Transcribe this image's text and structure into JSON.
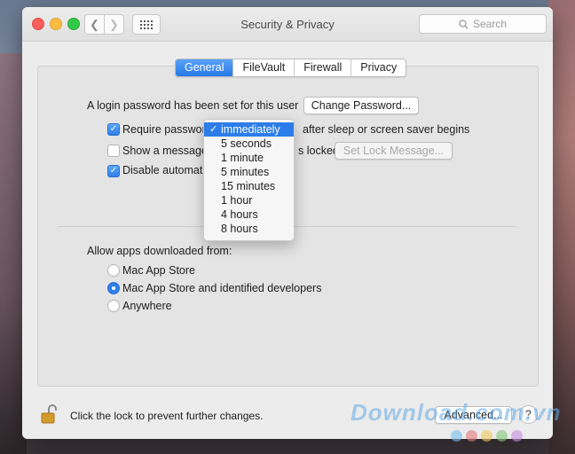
{
  "window": {
    "title": "Security & Privacy"
  },
  "search": {
    "placeholder": "Search"
  },
  "tabs": [
    {
      "label": "General",
      "active": true
    },
    {
      "label": "FileVault",
      "active": false
    },
    {
      "label": "Firewall",
      "active": false
    },
    {
      "label": "Privacy",
      "active": false
    }
  ],
  "general": {
    "login_text": "A login password has been set for this user",
    "change_password_label": "Change Password...",
    "require_password_label": "Require passwor",
    "require_password_checked": true,
    "require_password_suffix": "after sleep or screen saver begins",
    "show_message_label": "Show a message",
    "show_message_suffix": "s locked",
    "show_message_checked": false,
    "set_lock_message_label": "Set Lock Message...",
    "disable_auto_login_label": "Disable automati",
    "disable_auto_login_checked": true,
    "allow_apps_label": "Allow apps downloaded from:",
    "radio_options": [
      {
        "label": "Mac App Store",
        "selected": false
      },
      {
        "label": "Mac App Store and identified developers",
        "selected": true
      },
      {
        "label": "Anywhere",
        "selected": false
      }
    ]
  },
  "dropdown": {
    "selected": "immediately",
    "check_glyph": "✓",
    "options": [
      "immediately",
      "5 seconds",
      "1 minute",
      "5 minutes",
      "15 minutes",
      "1 hour",
      "4 hours",
      "8 hours"
    ]
  },
  "footer": {
    "lock_text": "Click the lock to prevent further changes.",
    "advanced_label": "Advanced...",
    "help_label": "?"
  },
  "watermark": {
    "text": "Download.com.vn"
  },
  "colors": {
    "accent": "#2c7de9",
    "close": "#fc605b",
    "minimize": "#fdbc40",
    "maximize": "#34c84a"
  }
}
